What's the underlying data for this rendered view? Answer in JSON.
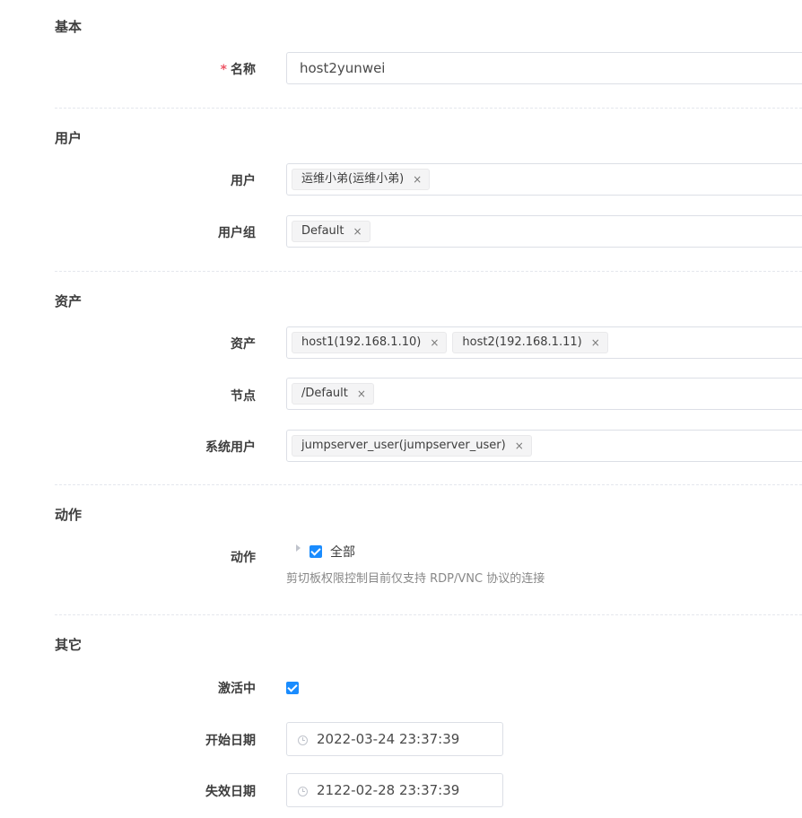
{
  "sections": {
    "basic": "基本",
    "users": "用户",
    "assets": "资产",
    "actions": "动作",
    "other": "其它"
  },
  "fields": {
    "name": {
      "required_mark": "*",
      "label": "名称",
      "value": "host2yunwei"
    },
    "users": {
      "label": "用户",
      "tags": [
        "运维小弟(运维小弟)"
      ]
    },
    "user_groups": {
      "label": "用户组",
      "tags": [
        "Default"
      ]
    },
    "assets": {
      "label": "资产",
      "tags": [
        "host1(192.168.1.10)",
        "host2(192.168.1.11)"
      ]
    },
    "nodes": {
      "label": "节点",
      "tags": [
        "/Default"
      ]
    },
    "system_users": {
      "label": "系统用户",
      "tags": [
        "jumpserver_user(jumpserver_user)"
      ]
    },
    "actions": {
      "label": "动作",
      "all_label": "全部",
      "help": "剪切板权限控制目前仅支持 RDP/VNC 协议的连接"
    },
    "active": {
      "label": "激活中",
      "checked": true
    },
    "date_start": {
      "label": "开始日期",
      "value": "2022-03-24 23:37:39"
    },
    "date_expired": {
      "label": "失效日期",
      "value": "2122-02-28 23:37:39"
    }
  },
  "icons": {
    "tag_close": "×",
    "clock": "clock-icon",
    "tree_toggle": "caret-right-icon"
  },
  "colors": {
    "accent": "#1a8cfe",
    "required": "#ed5565"
  }
}
